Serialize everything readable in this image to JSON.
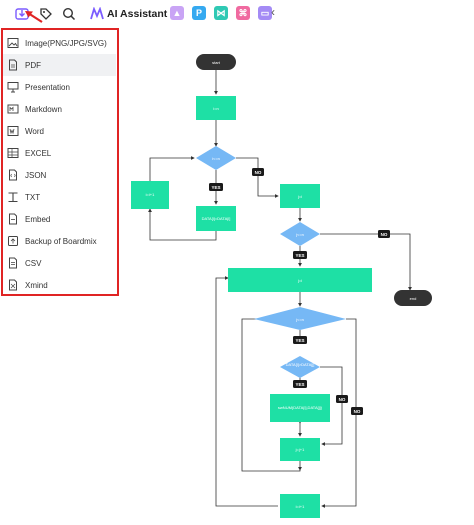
{
  "toolbar": {
    "export_icon": "export-icon",
    "tag_icon": "tag-icon",
    "search_icon": "search-icon",
    "ai_assistant_label": "AI Assistant",
    "colors": {
      "accent": "#7b5cff",
      "red": "#e02424"
    }
  },
  "export_menu": {
    "items": [
      {
        "label": "Image(PNG/JPG/SVG)",
        "icon": "image-icon"
      },
      {
        "label": "PDF",
        "icon": "pdf-file-icon"
      },
      {
        "label": "Presentation",
        "icon": "presentation-icon"
      },
      {
        "label": "Markdown",
        "icon": "markdown-icon"
      },
      {
        "label": "Word",
        "icon": "word-icon"
      },
      {
        "label": "EXCEL",
        "icon": "excel-icon"
      },
      {
        "label": "JSON",
        "icon": "json-icon"
      },
      {
        "label": "TXT",
        "icon": "txt-icon"
      },
      {
        "label": "Embed",
        "icon": "embed-icon"
      },
      {
        "label": "Backup of Boardmix",
        "icon": "backup-icon"
      },
      {
        "label": "CSV",
        "icon": "csv-icon"
      },
      {
        "label": "Xmind",
        "icon": "xmind-icon"
      }
    ],
    "selected": "PDF"
  },
  "flowchart": {
    "colors": {
      "process": "#1ee0a5",
      "decision": "#76b8f5",
      "terminal": "#333333",
      "label": "#1a1a1a"
    },
    "start": "start",
    "end": "end",
    "process_1": "i=n",
    "decision_1": "i<=n",
    "left_box": "i=i+1",
    "swap_box": "DATA[i]=DATA[i]",
    "process_2": "j=i",
    "decision_2": "j<=n",
    "wide_box": "j=i",
    "decision_3": "j<=n",
    "decision_4": "DATA[i]>DATA[j]",
    "swap_box_2": "swNUM(DATA[i],DATA[j])",
    "inc_j": "j=j+1",
    "inc_i": "i=i+1",
    "yes": "YES",
    "no": "NO"
  }
}
